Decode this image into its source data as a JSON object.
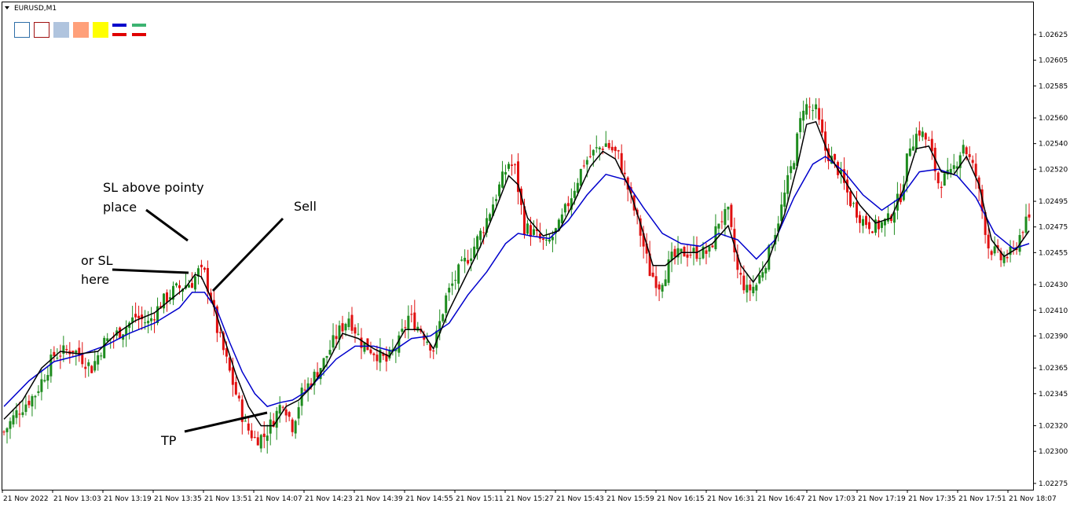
{
  "window": {
    "title": "EURUSD,M1",
    "menu_icon": "triangle-down-icon"
  },
  "toolbar": {
    "swatches": [
      {
        "name": "outline-blue-swatch",
        "stroke": "#2f6fa8",
        "fill": "#ffffff"
      },
      {
        "name": "outline-red-swatch",
        "stroke": "#a01010",
        "fill": "#ffffff"
      },
      {
        "name": "light-blue-swatch",
        "stroke": "#b0c4de",
        "fill": "#b0c4de"
      },
      {
        "name": "salmon-swatch",
        "stroke": "#ffa07a",
        "fill": "#ffa07a"
      },
      {
        "name": "yellow-swatch",
        "stroke": "#ffff00",
        "fill": "#ffff00"
      },
      {
        "name": "blue-red-lines-icon",
        "top": "#0000cc",
        "bottom": "#e00000"
      },
      {
        "name": "green-red-lines-icon",
        "top": "#3cb371",
        "bottom": "#e00000"
      }
    ]
  },
  "colors": {
    "bull_candle": "#1e8c1e",
    "bear_candle": "#e01010",
    "fast_ma": "#000000",
    "slow_ma": "#0000cc",
    "grid_axis": "#000000"
  },
  "annotations": {
    "sl_pointy": [
      "SL above pointy",
      "place"
    ],
    "or_sl": [
      "or SL",
      "here"
    ],
    "sell": "Sell",
    "tp": "TP"
  },
  "chart_data": {
    "type": "candlestick",
    "symbol": "EURUSD",
    "timeframe": "M1",
    "y_ticks": [
      "1.02625",
      "1.02605",
      "1.02585",
      "1.02560",
      "1.02540",
      "1.02520",
      "1.02495",
      "1.02475",
      "1.02455",
      "1.02430",
      "1.02410",
      "1.02390",
      "1.02365",
      "1.02345",
      "1.02320",
      "1.02300",
      "1.02275"
    ],
    "ylim": [
      1.02265,
      1.0264
    ],
    "x_ticks": [
      "21 Nov 2022",
      "21 Nov 13:03",
      "21 Nov 13:19",
      "21 Nov 13:35",
      "21 Nov 13:51",
      "21 Nov 14:07",
      "21 Nov 14:23",
      "21 Nov 14:39",
      "21 Nov 14:55",
      "21 Nov 15:11",
      "21 Nov 15:27",
      "21 Nov 15:43",
      "21 Nov 15:59",
      "21 Nov 16:15",
      "21 Nov 16:31",
      "21 Nov 16:47",
      "21 Nov 17:03",
      "21 Nov 17:19",
      "21 Nov 17:35",
      "21 Nov 17:51",
      "21 Nov 18:07"
    ],
    "bar_count": 328,
    "close_path": [
      [
        0,
        1.02315
      ],
      [
        4,
        1.0233
      ],
      [
        10,
        1.02345
      ],
      [
        16,
        1.02375
      ],
      [
        22,
        1.0238
      ],
      [
        28,
        1.02365
      ],
      [
        32,
        1.02385
      ],
      [
        38,
        1.02395
      ],
      [
        42,
        1.02405
      ],
      [
        46,
        1.024
      ],
      [
        50,
        1.02415
      ],
      [
        54,
        1.02425
      ],
      [
        58,
        1.0243
      ],
      [
        60,
        1.02432
      ],
      [
        62,
        1.0244
      ],
      [
        64,
        1.02438
      ],
      [
        66,
        1.0242
      ],
      [
        68,
        1.02395
      ],
      [
        71,
        1.0237
      ],
      [
        74,
        1.02345
      ],
      [
        77,
        1.0232
      ],
      [
        80,
        1.0231
      ],
      [
        83,
        1.02312
      ],
      [
        86,
        1.02325
      ],
      [
        89,
        1.0234
      ],
      [
        92,
        1.0232
      ],
      [
        95,
        1.02345
      ],
      [
        98,
        1.02355
      ],
      [
        102,
        1.0237
      ],
      [
        106,
        1.0239
      ],
      [
        110,
        1.02405
      ],
      [
        114,
        1.02385
      ],
      [
        118,
        1.02378
      ],
      [
        122,
        1.0237
      ],
      [
        126,
        1.02385
      ],
      [
        129,
        1.02405
      ],
      [
        133,
        1.02395
      ],
      [
        137,
        1.0238
      ],
      [
        141,
        1.0242
      ],
      [
        145,
        1.0244
      ],
      [
        149,
        1.02455
      ],
      [
        153,
        1.02475
      ],
      [
        157,
        1.025
      ],
      [
        161,
        1.02525
      ],
      [
        163,
        1.0252
      ],
      [
        166,
        1.02475
      ],
      [
        169,
        1.0247
      ],
      [
        173,
        1.0246
      ],
      [
        177,
        1.02475
      ],
      [
        181,
        1.025
      ],
      [
        185,
        1.02525
      ],
      [
        189,
        1.02535
      ],
      [
        192,
        1.0254
      ],
      [
        196,
        1.0253
      ],
      [
        199,
        1.02505
      ],
      [
        202,
        1.0248
      ],
      [
        206,
        1.0244
      ],
      [
        209,
        1.0243
      ],
      [
        213,
        1.0245
      ],
      [
        217,
        1.02455
      ],
      [
        221,
        1.02455
      ],
      [
        225,
        1.02455
      ],
      [
        228,
        1.0248
      ],
      [
        231,
        1.02485
      ],
      [
        234,
        1.0244
      ],
      [
        237,
        1.02425
      ],
      [
        240,
        1.0243
      ],
      [
        244,
        1.02455
      ],
      [
        248,
        1.0249
      ],
      [
        252,
        1.0253
      ],
      [
        255,
        1.0257
      ],
      [
        259,
        1.02565
      ],
      [
        262,
        1.02535
      ],
      [
        266,
        1.0252
      ],
      [
        270,
        1.02495
      ],
      [
        274,
        1.0248
      ],
      [
        278,
        1.02475
      ],
      [
        282,
        1.0248
      ],
      [
        286,
        1.025
      ],
      [
        289,
        1.0254
      ],
      [
        292,
        1.0255
      ],
      [
        295,
        1.0254
      ],
      [
        298,
        1.0251
      ],
      [
        302,
        1.02515
      ],
      [
        306,
        1.0254
      ],
      [
        310,
        1.02515
      ],
      [
        314,
        1.0246
      ],
      [
        318,
        1.0245
      ],
      [
        322,
        1.02455
      ],
      [
        325,
        1.02475
      ],
      [
        327,
        1.0248
      ]
    ],
    "fast_ma_path": [
      [
        0,
        1.02325
      ],
      [
        6,
        1.0234
      ],
      [
        12,
        1.02365
      ],
      [
        18,
        1.02378
      ],
      [
        24,
        1.02376
      ],
      [
        30,
        1.02378
      ],
      [
        36,
        1.02392
      ],
      [
        42,
        1.02402
      ],
      [
        48,
        1.02408
      ],
      [
        54,
        1.0242
      ],
      [
        58,
        1.02428
      ],
      [
        61,
        1.02438
      ],
      [
        63,
        1.02436
      ],
      [
        66,
        1.0242
      ],
      [
        70,
        1.0239
      ],
      [
        74,
        1.0236
      ],
      [
        78,
        1.02335
      ],
      [
        82,
        1.0232
      ],
      [
        86,
        1.0232
      ],
      [
        90,
        1.02335
      ],
      [
        94,
        1.0234
      ],
      [
        98,
        1.0235
      ],
      [
        103,
        1.02368
      ],
      [
        108,
        1.02392
      ],
      [
        113,
        1.02388
      ],
      [
        118,
        1.0238
      ],
      [
        123,
        1.02374
      ],
      [
        128,
        1.02395
      ],
      [
        133,
        1.02395
      ],
      [
        137,
        1.0238
      ],
      [
        142,
        1.0241
      ],
      [
        147,
        1.02435
      ],
      [
        152,
        1.0246
      ],
      [
        157,
        1.0249
      ],
      [
        161,
        1.02515
      ],
      [
        164,
        1.02508
      ],
      [
        167,
        1.02482
      ],
      [
        172,
        1.02468
      ],
      [
        177,
        1.02472
      ],
      [
        182,
        1.02495
      ],
      [
        187,
        1.02522
      ],
      [
        191,
        1.02534
      ],
      [
        195,
        1.02528
      ],
      [
        199,
        1.02508
      ],
      [
        203,
        1.02478
      ],
      [
        207,
        1.02445
      ],
      [
        211,
        1.02445
      ],
      [
        216,
        1.02455
      ],
      [
        221,
        1.02455
      ],
      [
        226,
        1.02462
      ],
      [
        231,
        1.02476
      ],
      [
        235,
        1.02445
      ],
      [
        239,
        1.02432
      ],
      [
        244,
        1.0245
      ],
      [
        249,
        1.02485
      ],
      [
        253,
        1.02522
      ],
      [
        256,
        1.02555
      ],
      [
        259,
        1.02557
      ],
      [
        263,
        1.02532
      ],
      [
        268,
        1.02512
      ],
      [
        273,
        1.02492
      ],
      [
        278,
        1.02478
      ],
      [
        283,
        1.02482
      ],
      [
        287,
        1.02505
      ],
      [
        291,
        1.02536
      ],
      [
        295,
        1.02538
      ],
      [
        299,
        1.02518
      ],
      [
        303,
        1.02516
      ],
      [
        307,
        1.0253
      ],
      [
        311,
        1.02508
      ],
      [
        315,
        1.02465
      ],
      [
        319,
        1.02452
      ],
      [
        323,
        1.02458
      ],
      [
        327,
        1.02472
      ]
    ],
    "slow_ma_path": [
      [
        0,
        1.02335
      ],
      [
        8,
        1.02355
      ],
      [
        16,
        1.0237
      ],
      [
        24,
        1.02375
      ],
      [
        32,
        1.02382
      ],
      [
        40,
        1.02392
      ],
      [
        48,
        1.024
      ],
      [
        56,
        1.02412
      ],
      [
        60,
        1.02424
      ],
      [
        64,
        1.02424
      ],
      [
        68,
        1.0241
      ],
      [
        72,
        1.02385
      ],
      [
        76,
        1.02362
      ],
      [
        80,
        1.02345
      ],
      [
        84,
        1.02335
      ],
      [
        88,
        1.02338
      ],
      [
        92,
        1.0234
      ],
      [
        96,
        1.02346
      ],
      [
        100,
        1.02356
      ],
      [
        106,
        1.02372
      ],
      [
        112,
        1.02382
      ],
      [
        118,
        1.02382
      ],
      [
        124,
        1.02378
      ],
      [
        130,
        1.02388
      ],
      [
        136,
        1.0239
      ],
      [
        142,
        1.024
      ],
      [
        148,
        1.02422
      ],
      [
        154,
        1.0244
      ],
      [
        160,
        1.02462
      ],
      [
        164,
        1.0247
      ],
      [
        168,
        1.02468
      ],
      [
        174,
        1.02466
      ],
      [
        180,
        1.0248
      ],
      [
        186,
        1.025
      ],
      [
        192,
        1.02516
      ],
      [
        198,
        1.02512
      ],
      [
        204,
        1.0249
      ],
      [
        210,
        1.0247
      ],
      [
        216,
        1.02462
      ],
      [
        222,
        1.0246
      ],
      [
        228,
        1.0247
      ],
      [
        234,
        1.02465
      ],
      [
        240,
        1.0245
      ],
      [
        246,
        1.02465
      ],
      [
        252,
        1.02498
      ],
      [
        258,
        1.02524
      ],
      [
        262,
        1.0253
      ],
      [
        268,
        1.02518
      ],
      [
        274,
        1.025
      ],
      [
        280,
        1.02488
      ],
      [
        286,
        1.02498
      ],
      [
        292,
        1.02518
      ],
      [
        298,
        1.0252
      ],
      [
        304,
        1.02515
      ],
      [
        310,
        1.02498
      ],
      [
        316,
        1.0247
      ],
      [
        322,
        1.02458
      ],
      [
        327,
        1.02462
      ]
    ]
  }
}
